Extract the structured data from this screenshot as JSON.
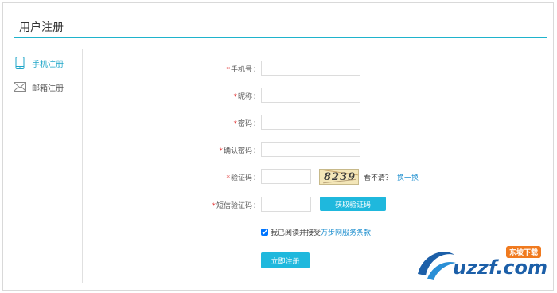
{
  "header": {
    "title": "用户注册"
  },
  "sidebar": {
    "items": [
      {
        "label": "手机注册",
        "icon": "phone-icon",
        "active": true
      },
      {
        "label": "邮箱注册",
        "icon": "envelope-icon",
        "active": false
      }
    ]
  },
  "form": {
    "required_mark": "*",
    "colon": "：",
    "phone": {
      "label": "手机号",
      "value": "",
      "placeholder": ""
    },
    "nickname": {
      "label": "昵称",
      "value": "",
      "placeholder": ""
    },
    "password": {
      "label": "密码",
      "value": "",
      "placeholder": ""
    },
    "confirm_password": {
      "label": "确认密码",
      "value": "",
      "placeholder": ""
    },
    "captcha": {
      "label": "验证码",
      "value": "",
      "image_text": "8239",
      "unclear_text": "看不清？",
      "refresh_label": "换一换"
    },
    "sms_code": {
      "label": "短信验证码",
      "value": "",
      "button_label": "获取验证码"
    },
    "agreement": {
      "checked": true,
      "text": "我已阅读并接受",
      "terms_link": "万步网服务条款"
    },
    "submit_label": "立即注册"
  },
  "watermark": {
    "text": "uzzf.com",
    "badge": "东坡下载"
  },
  "colors": {
    "accent": "#1fb8dd",
    "link": "#1e8fcf",
    "required": "#e23b3b",
    "divider": "#1fb3cc"
  }
}
